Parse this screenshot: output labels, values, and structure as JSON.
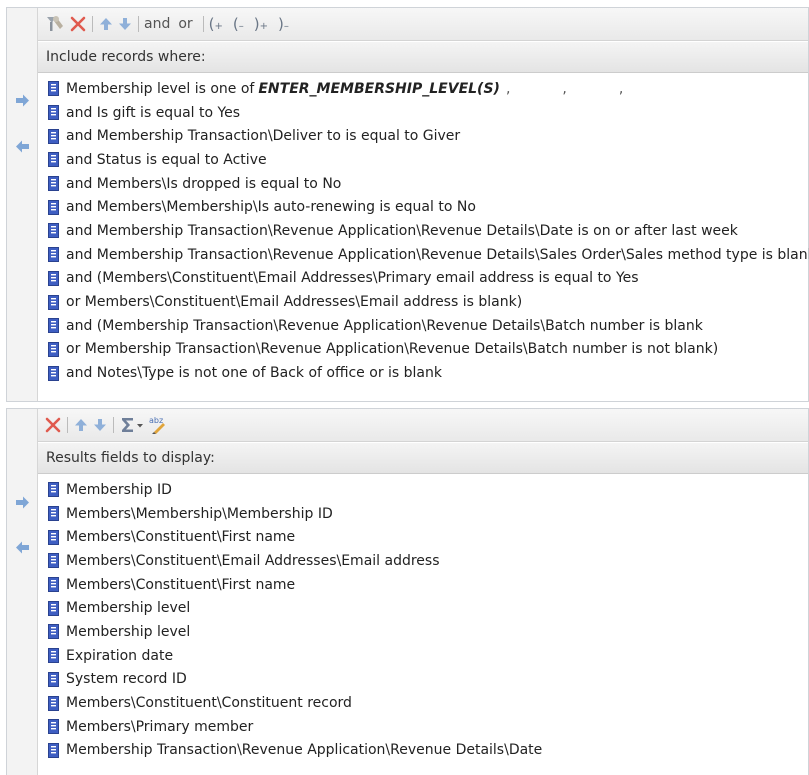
{
  "filters": {
    "toolbar": {
      "and_label": "and",
      "or_label": "or"
    },
    "header": "Include records where:",
    "rows": [
      {
        "text": "Membership level is one of",
        "criteria": "ENTER_MEMBERSHIP_LEVEL(S)"
      },
      {
        "text": "and Is gift is equal to Yes"
      },
      {
        "text": "and Membership Transaction\\Deliver to is equal to Giver"
      },
      {
        "text": "and Status is equal to Active"
      },
      {
        "text": "and Members\\Is dropped is equal to No"
      },
      {
        "text": "and Members\\Membership\\Is auto-renewing is equal to No"
      },
      {
        "text": "and Membership Transaction\\Revenue Application\\Revenue Details\\Date is on or after last week"
      },
      {
        "text": "and Membership Transaction\\Revenue Application\\Revenue Details\\Sales Order\\Sales method type is blank"
      },
      {
        "text": "and (Members\\Constituent\\Email Addresses\\Primary email address is equal to Yes"
      },
      {
        "text": "or Members\\Constituent\\Email Addresses\\Email address is blank)"
      },
      {
        "text": "and (Membership Transaction\\Revenue Application\\Revenue Details\\Batch number is blank"
      },
      {
        "text": "or Membership Transaction\\Revenue Application\\Revenue Details\\Batch number is not blank)"
      },
      {
        "text": "and Notes\\Type is not one of Back of office or is blank"
      }
    ]
  },
  "results": {
    "header": "Results fields to display:",
    "rows": [
      "Membership ID",
      "Members\\Membership\\Membership ID",
      "Members\\Constituent\\First name",
      "Members\\Constituent\\Email Addresses\\Email address",
      "Members\\Constituent\\First name",
      "Membership level",
      "Membership level",
      "Expiration date",
      "System record ID",
      "Members\\Constituent\\Constituent record",
      "Members\\Primary member",
      "Membership Transaction\\Revenue Application\\Revenue Details\\Date"
    ]
  }
}
